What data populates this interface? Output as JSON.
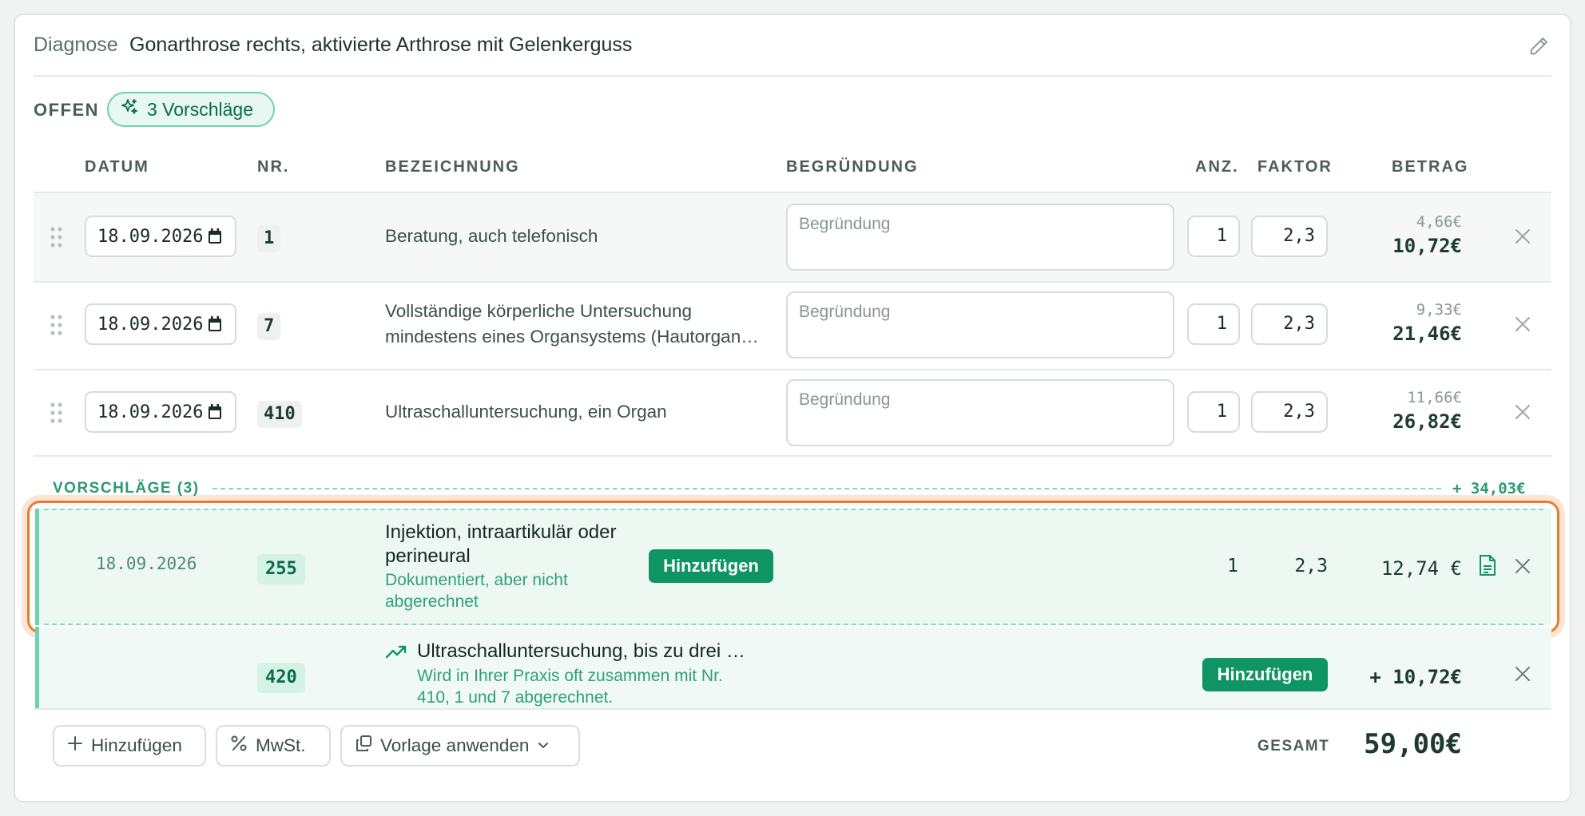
{
  "header": {
    "diagnose_label": "Diagnose",
    "diagnose_text": "Gonarthrose rechts, aktivierte Arthrose mit Gelenkerguss",
    "status_label": "OFFEN",
    "suggestions_badge": "3 Vorschläge"
  },
  "columns": {
    "datum": "DATUM",
    "nr": "NR.",
    "bezeichnung": "BEZEICHNUNG",
    "begruendung": "BEGRÜNDUNG",
    "anz": "ANZ.",
    "faktor": "FAKTOR",
    "betrag": "BETRAG"
  },
  "rows": [
    {
      "date": "18.09.2026",
      "nr": "1",
      "bezeichnung_line1": "Beratung, auch telefonisch",
      "bezeichnung_line2": "",
      "begruendung_placeholder": "Begründung",
      "anz": "1",
      "faktor": "2,3",
      "betrag_base": "4,66€",
      "betrag_total": "10,72€"
    },
    {
      "date": "18.09.2026",
      "nr": "7",
      "bezeichnung_line1": "Vollständige körperliche Untersuchung",
      "bezeichnung_line2": "mindestens eines Organsystems (Hautorgan…",
      "begruendung_placeholder": "Begründung",
      "anz": "1",
      "faktor": "2,3",
      "betrag_base": "9,33€",
      "betrag_total": "21,46€"
    },
    {
      "date": "18.09.2026",
      "nr": "410",
      "bezeichnung_line1": "Ultraschalluntersuchung, ein Organ",
      "bezeichnung_line2": "",
      "begruendung_placeholder": "Begründung",
      "anz": "1",
      "faktor": "2,3",
      "betrag_base": "11,66€",
      "betrag_total": "26,82€"
    }
  ],
  "suggestions": {
    "label": "VORSCHLÄGE (3)",
    "sum": "+ 34,03€",
    "items": [
      {
        "date": "18.09.2026",
        "nr": "255",
        "title_line1": "Injektion, intraartikulär oder",
        "title_line2": "perineural",
        "sub_line1": "Dokumentiert, aber nicht",
        "sub_line2": "abgerechnet",
        "add_label": "Hinzufügen",
        "anz": "1",
        "faktor": "2,3",
        "betrag": "12,74 €"
      },
      {
        "nr": "420",
        "title": "Ultraschalluntersuchung, bis zu drei …",
        "sub_line1": "Wird in Ihrer Praxis oft zusammen mit Nr.",
        "sub_line2": "410, 1 und 7 abgerechnet.",
        "add_label": "Hinzufügen",
        "betrag": "+ 10,72€"
      }
    ]
  },
  "footer": {
    "add_label": "Hinzufügen",
    "mwst_label": "MwSt.",
    "template_label": "Vorlage anwenden",
    "total_label": "GESAMT",
    "total_value": "59,00€"
  },
  "colors": {
    "accent": "#0f9463",
    "accent_light": "#e6f8f1",
    "highlight_outline": "#ea7b2c",
    "text_dark": "#1e3b32"
  },
  "icons": [
    "pencil-icon",
    "sparkles-icon",
    "drag-handle-icon",
    "calendar-icon",
    "close-icon",
    "document-icon",
    "trending-up-icon",
    "plus-icon",
    "percent-icon",
    "copy-icon",
    "chevron-down-icon"
  ]
}
